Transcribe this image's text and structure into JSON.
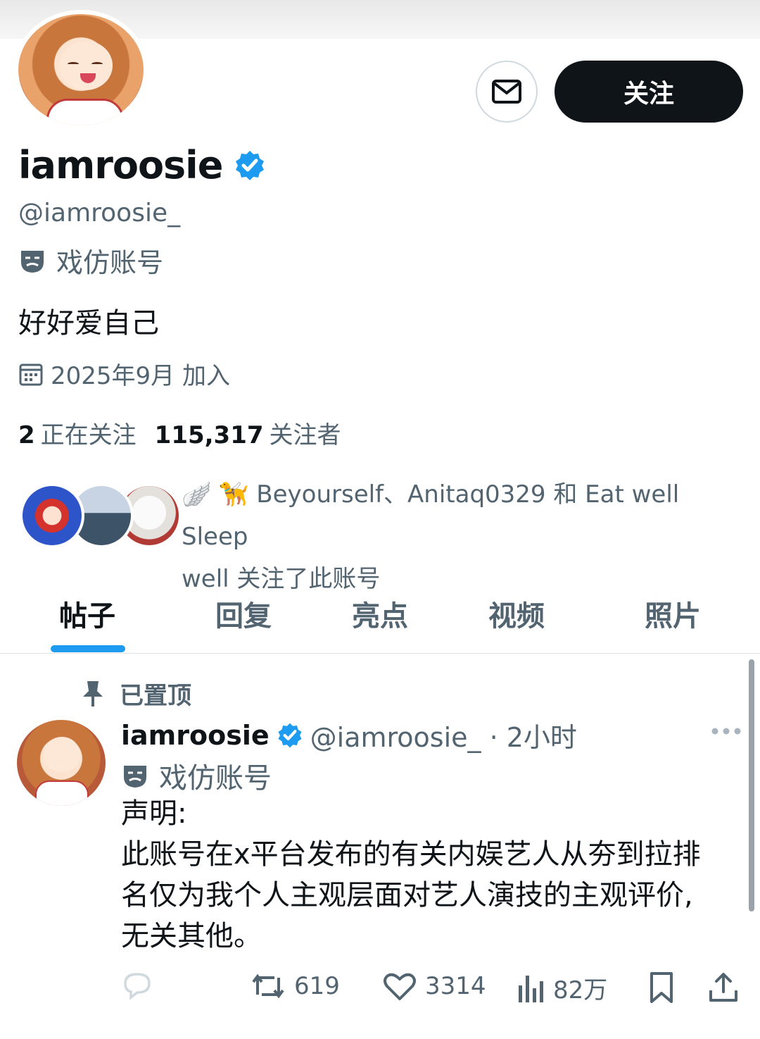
{
  "profile": {
    "display_name": "iamroosie",
    "handle": "@iamroosie_",
    "parody_label": "戏仿账号",
    "bio": "好好爱自己",
    "joined": "2025年9月 加入",
    "following_count": "2",
    "following_label": "正在关注",
    "followers_count": "115,317",
    "followers_label": "关注者",
    "follow_button": "关注",
    "followed_by_line1": "🪽 🦮 Beyourself、Anitaq0329 和 Eat well Sleep",
    "followed_by_line2": "well 关注了此账号"
  },
  "tabs": [
    "帖子",
    "回复",
    "亮点",
    "视频",
    "照片"
  ],
  "pinned_label": "已置顶",
  "post": {
    "name": "iamroosie",
    "handle_time": "@iamroosie_ · 2小时",
    "parody_label": "戏仿账号",
    "text_lines": [
      "声明:",
      "此账号在x平台发布的有关内娱艺人从夯到拉排",
      "名仅为我个人主观层面对艺人演技的主观评价,",
      "无关其他。"
    ],
    "retweets": "619",
    "likes": "3314",
    "views": "82万"
  },
  "colors": {
    "accent": "#1d9bf0",
    "text": "#0f1419",
    "secondary": "#536471"
  }
}
